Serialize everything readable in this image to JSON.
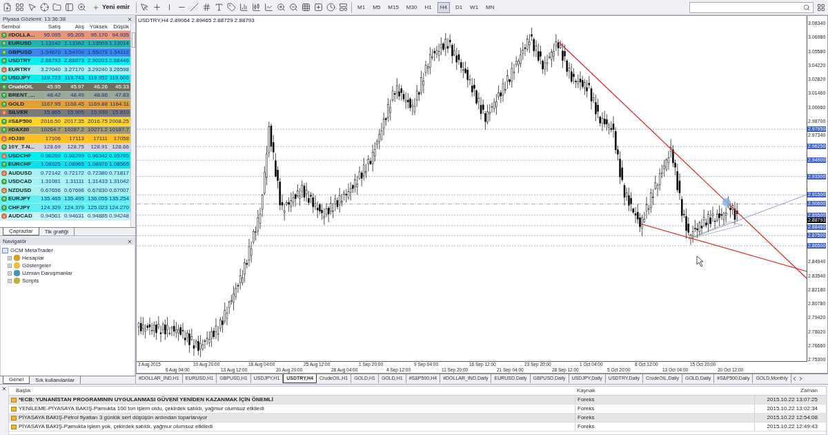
{
  "toolbar": {
    "new_order_button": "Yeni emir",
    "timeframes": [
      {
        "label": "M1",
        "selected": false
      },
      {
        "label": "M5",
        "selected": false
      },
      {
        "label": "M15",
        "selected": false
      },
      {
        "label": "M30",
        "selected": false
      },
      {
        "label": "H1",
        "selected": false
      },
      {
        "label": "H4",
        "selected": true
      },
      {
        "label": "D1",
        "selected": false
      },
      {
        "label": "W1",
        "selected": false
      },
      {
        "label": "MN",
        "selected": false
      }
    ]
  },
  "market_watch": {
    "title": "Piyasa Gözlemi: 13:36:38",
    "columns": [
      "Sembol",
      "Satış",
      "Alış",
      "Yüksek",
      "Düşük"
    ],
    "rows": [
      {
        "symbol": "#DOLLA...",
        "rising": true,
        "color": "#e8967a",
        "quote": {
          "bid": "95.095",
          "ask": "95.205",
          "high": "95.170",
          "low": "94.935"
        }
      },
      {
        "symbol": "EURUSD",
        "rising": true,
        "color": "#22b5ad",
        "quote": {
          "bid": "1.13142",
          "ask": "1.13162",
          "high": "1.13503",
          "low": "1.13014"
        }
      },
      {
        "symbol": "GBPUSD",
        "rising": true,
        "color": "#3a86ee",
        "quote": {
          "bid": "1.54670",
          "ask": "1.54700",
          "high": "1.55079",
          "low": "1.54112"
        }
      },
      {
        "symbol": "USDTRY",
        "rising": true,
        "color": "#00f0f0",
        "quote": {
          "bid": "2.88793",
          "ask": "2.88873",
          "high": "2.90203",
          "low": "2.88446"
        }
      },
      {
        "symbol": "EURTRY",
        "rising": false,
        "color": "#a6f2f2",
        "quote": {
          "bid": "3.27040",
          "ask": "3.27170",
          "high": "3.29240",
          "low": "3.26598"
        }
      },
      {
        "symbol": "USDJPY",
        "rising": true,
        "color": "#00f0f0",
        "quote": {
          "bid": "119.723",
          "ask": "119.743",
          "high": "119.952",
          "low": "119.606"
        }
      },
      {
        "symbol": "CrudeOIL",
        "rising": true,
        "color": "#6f705e",
        "quote": {
          "bid": "45.95",
          "ask": "45.97",
          "high": "46.26",
          "low": "45.33"
        }
      },
      {
        "symbol": "BRENT_...",
        "rising": true,
        "color": "#9aaa98",
        "quote": {
          "bid": "48.42",
          "ask": "48.49",
          "high": "48.86",
          "low": "47.83"
        }
      },
      {
        "symbol": "GOLD",
        "rising": true,
        "color": "#e2a132",
        "quote": {
          "bid": "1167.95",
          "ask": "1168.45",
          "high": "1169.88",
          "low": "1164.11"
        }
      },
      {
        "symbol": "SILVER",
        "rising": false,
        "color": "#7a7a7a",
        "quote": {
          "bid": "15.865",
          "ask": "15.905",
          "high": "15.930",
          "low": "15.810"
        }
      },
      {
        "symbol": "#S&P500",
        "rising": true,
        "color": "#ffd426",
        "quote": {
          "bid": "2016.50",
          "ask": "2017.35",
          "high": "2016.75",
          "low": "2008.25"
        }
      },
      {
        "symbol": "#DAX30",
        "rising": true,
        "color": "#a39a72",
        "quote": {
          "bid": "10264.7",
          "ask": "10287.2",
          "high": "10271.2",
          "low": "10187.7"
        }
      },
      {
        "symbol": "#DJ30",
        "rising": false,
        "color": "#ffc020",
        "quote": {
          "bid": "17106",
          "ask": "17113",
          "high": "17111",
          "low": "17058"
        }
      },
      {
        "symbol": "10Y_T-N...",
        "rising": true,
        "color": "#d6d6da",
        "quote": {
          "bid": "128.69",
          "ask": "128.75",
          "high": "128.91",
          "low": "128.66"
        }
      },
      {
        "symbol": "USDCHF",
        "rising": false,
        "color": "#00f0f0",
        "quote": {
          "bid": "0.96269",
          "ask": "0.96299",
          "high": "0.96342",
          "low": "0.95785"
        }
      },
      {
        "symbol": "EURCHF",
        "rising": true,
        "color": "#10e0e8",
        "quote": {
          "bid": "1.08925",
          "ask": "1.08965",
          "high": "1.08976",
          "low": "1.08565"
        }
      },
      {
        "symbol": "AUDUSD",
        "rising": false,
        "color": "#a6f2f2",
        "quote": {
          "bid": "0.72142",
          "ask": "0.72172",
          "high": "0.72380",
          "low": "0.71817"
        }
      },
      {
        "symbol": "USDCAD",
        "rising": true,
        "color": "#a6f2f2",
        "quote": {
          "bid": "1.31081",
          "ask": "1.31111",
          "high": "1.31433",
          "low": "1.31042"
        }
      },
      {
        "symbol": "NZDUSD",
        "rising": false,
        "color": "#a6f2f2",
        "quote": {
          "bid": "0.67656",
          "ask": "0.67696",
          "high": "0.67830",
          "low": "0.67007"
        }
      },
      {
        "symbol": "EURJPY",
        "rising": true,
        "color": "#5cf0f4",
        "quote": {
          "bid": "135.465",
          "ask": "135.495",
          "high": "136.055",
          "low": "135.254"
        }
      },
      {
        "symbol": "CHFJPY",
        "rising": true,
        "color": "#5cf0f4",
        "quote": {
          "bid": "124.329",
          "ask": "124.379",
          "high": "125.023",
          "low": "124.270"
        }
      },
      {
        "symbol": "AUDCAD",
        "rising": false,
        "color": "#c8f4f4",
        "quote": {
          "bid": "0.94561",
          "ask": "0.94631",
          "high": "0.94885",
          "low": "0.94248"
        }
      }
    ],
    "tabs": [
      {
        "label": "Çaprazlar",
        "selected": true
      },
      {
        "label": "Tik grafiği",
        "selected": false
      }
    ]
  },
  "navigator": {
    "title": "Navigatör",
    "tree": [
      {
        "label": "GCM MetaTrader",
        "children": [
          {
            "label": "Hesaplar",
            "expanded": false
          },
          {
            "label": "Göstergeler",
            "expanded": false
          },
          {
            "label": "Uzman Danışmanlar",
            "expanded": false
          },
          {
            "label": "Scripts",
            "expanded": false
          }
        ]
      }
    ],
    "tabs": [
      {
        "label": "Genel",
        "selected": true
      },
      {
        "label": "Sık kullanılanlar",
        "selected": false
      }
    ]
  },
  "chart": {
    "title": "USDTRY,H4 2.89064 2.89465 2.88729 2.88793",
    "price_ticks": [
      "3.08340",
      "3.06980",
      "3.05580",
      "3.04220",
      "3.02820",
      "3.01460",
      "3.00060",
      "2.98700",
      "2.97340",
      "2.84940",
      "2.83540",
      "2.82180",
      "2.80780",
      "2.79420",
      "2.78020",
      "2.76660",
      "2.75300"
    ],
    "level_labels": [
      "2.97950",
      "2.96250",
      "2.94900",
      "2.93300",
      "2.91500",
      "2.90600",
      "2.89500",
      "2.88460",
      "2.87500",
      "2.86500"
    ],
    "current_price": "2.88793",
    "time_labels": [
      "3 Aug 2015",
      "6 Aug 04:00",
      "10 Aug 20:00",
      "13 Aug 12:00",
      "18 Aug 04:00",
      "20 Aug 20:00",
      "25 Aug 12:00",
      "28 Aug 04:00",
      "1 Sep 20:00",
      "4 Sep 12:00",
      "9 Sep 04:00",
      "11 Sep 20:00",
      "16 Sep 12:00",
      "21 Sep 04:00",
      "23 Sep 20:00",
      "28 Sep 12:00",
      "1 Oct 04:00",
      "5 Oct 20:00",
      "8 Oct 12:00",
      "13 Oct 04:00",
      "15 Oct 20:00",
      "20 Oct 12:00"
    ]
  },
  "chart_tabs": [
    {
      "label": "#DOLLAR_IND,H1",
      "selected": false
    },
    {
      "label": "EURUSD,H1",
      "selected": false
    },
    {
      "label": "GBPUSD,H1",
      "selected": false
    },
    {
      "label": "USDJPY,H1",
      "selected": false
    },
    {
      "label": "USDTRY,H4",
      "selected": true
    },
    {
      "label": "CrudeOIL,H1",
      "selected": false
    },
    {
      "label": "GOLD,H1",
      "selected": false
    },
    {
      "label": "GOLD,H1",
      "selected": false
    },
    {
      "label": "#S&P500,H4",
      "selected": false
    },
    {
      "label": "#DOLLAR_IND,Daily",
      "selected": false
    },
    {
      "label": "EURUSD,Daily",
      "selected": false
    },
    {
      "label": "GBPUSD,Daily",
      "selected": false
    },
    {
      "label": "USDJPY,Daily",
      "selected": false
    },
    {
      "label": "USDTRY,Daily",
      "selected": false
    },
    {
      "label": "CrudeOIL,Daily",
      "selected": false
    },
    {
      "label": "GOLD,Daily",
      "selected": false
    },
    {
      "label": "#S&P500,Daily",
      "selected": false
    },
    {
      "label": "GOLD,Monthly",
      "selected": false
    }
  ],
  "news": {
    "columns": [
      "Başlık",
      "Kaynak",
      "Zaman"
    ],
    "rows": [
      {
        "title": "*ECB: YUNANİSTAN PROGRAMININ UYGULANMASI GÜVENİ YENİDEN KAZANMAK İÇİN ÖNEMLİ",
        "source": "Foreks",
        "time": "2015.10.22 13:07:25",
        "unread": true
      },
      {
        "title": "YENİLEME-PİYASAYA BAKIŞ-Pamukta 100 ton işlem oldu, çekirdek satıldı, yağmur olumsuz etkiledi",
        "source": "Foreks",
        "time": "2015.10.22 13:02:34",
        "unread": false
      },
      {
        "title": "PİYASAYA BAKIŞ-Petrol fiyatları 3 günlük sert düşüşün ardından toparlanıyor",
        "source": "Foreks",
        "time": "2015.10.22 12:54:08",
        "unread": false
      },
      {
        "title": "PİYASAYA BAKIŞ-Pamukta işlem yok, çekirdek satıldı, yağmur olumsuz etkiledi",
        "source": "Foreks",
        "time": "2015.10.22 12:49:43",
        "unread": false
      }
    ]
  }
}
